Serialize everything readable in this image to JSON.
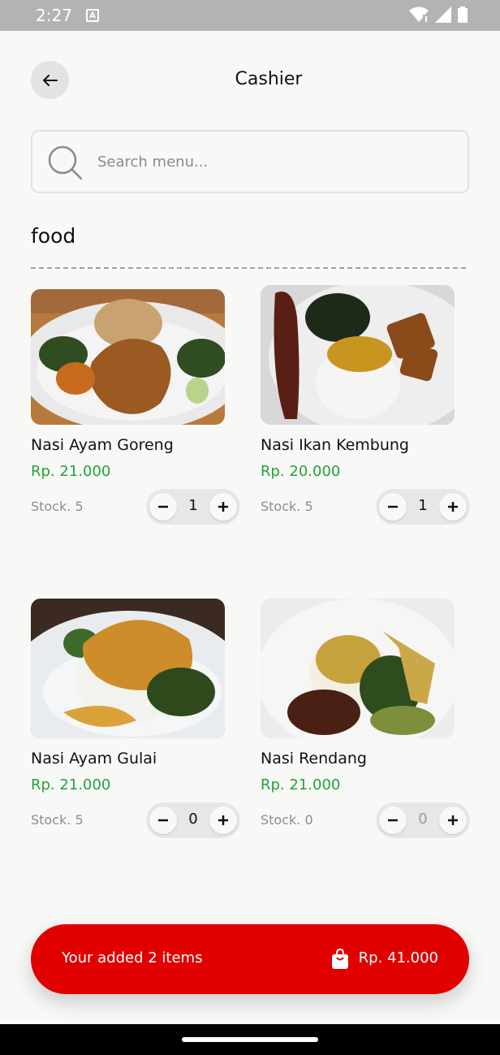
{
  "status_bar": {
    "time": "2:27",
    "notification_icon": "a-icon",
    "icons": [
      "wifi-icon",
      "signal-icon",
      "battery-icon"
    ]
  },
  "header": {
    "title": "Cashier",
    "back_icon": "arrow-left-icon"
  },
  "search": {
    "placeholder": "Search menu...",
    "value": "",
    "icon": "search-icon"
  },
  "category": {
    "title": "food"
  },
  "items": [
    {
      "name": "Nasi Ayam Goreng",
      "price": "Rp. 21.000",
      "stock": "Stock. 5",
      "qty": "1",
      "image": "fried-chicken-rice-image"
    },
    {
      "name": "Nasi Ikan Kembung",
      "price": "Rp. 20.000",
      "stock": "Stock. 5",
      "qty": "1",
      "image": "mackerel-rice-image"
    },
    {
      "name": "Nasi Ayam Gulai",
      "price": "Rp. 21.000",
      "stock": "Stock. 5",
      "qty": "0",
      "image": "curry-chicken-rice-image"
    },
    {
      "name": "Nasi Rendang",
      "price": "Rp. 21.000",
      "stock": "Stock. 0",
      "qty": "0",
      "image": "rendang-rice-image"
    }
  ],
  "cart": {
    "summary": "Your added 2 items",
    "total": "Rp. 41.000",
    "icon": "shopping-bag-icon"
  },
  "colors": {
    "accent_red": "#e00000",
    "price_green": "#21a33a",
    "background": "#f8f8f6",
    "status_bar": "#b3b3b3"
  }
}
